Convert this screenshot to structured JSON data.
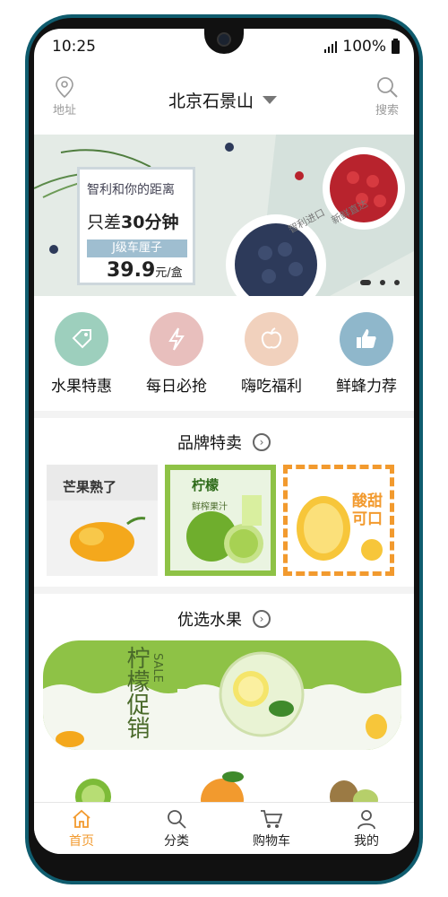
{
  "status_bar": {
    "time": "10:25",
    "battery": "100%"
  },
  "topbar": {
    "location_label": "地址",
    "city": "北京石景山",
    "search_label": "搜索"
  },
  "banner": {
    "headline": "智利和你的距离",
    "time_text_pre": "只差",
    "time_text_bold": "30分钟",
    "grade": "J级车厘子",
    "price": "39.9",
    "price_unit": "元/盒",
    "side_text_1": "智利进口",
    "side_text_2": "新鲜直达"
  },
  "categories": [
    {
      "label": "水果特惠",
      "color": "#9dcfbd",
      "icon": "tag-icon"
    },
    {
      "label": "每日必抢",
      "color": "#e8bfbd",
      "icon": "lightning-icon"
    },
    {
      "label": "嗨吃福利",
      "color": "#f1d1bd",
      "icon": "apple-icon"
    },
    {
      "label": "鲜蜂力荐",
      "color": "#8fb7cb",
      "icon": "thumbs-up-icon"
    }
  ],
  "brand_section": {
    "title": "品牌特卖",
    "items": [
      {
        "text": "芒果熟了"
      },
      {
        "text": "柠檬",
        "sub": "鲜榨果汁"
      },
      {
        "text": "酸甜可口"
      }
    ]
  },
  "fruit_section": {
    "title": "优选水果",
    "promo_title": "柠檬促销",
    "promo_sub": "SALE"
  },
  "nav": [
    {
      "label": "首页",
      "icon": "home-icon",
      "active": true
    },
    {
      "label": "分类",
      "icon": "search-icon",
      "active": false
    },
    {
      "label": "购物车",
      "icon": "cart-icon",
      "active": false
    },
    {
      "label": "我的",
      "icon": "user-icon",
      "active": false
    }
  ],
  "colors": {
    "accent": "#f29a2e",
    "frame": "#0f5c6e",
    "promo_green": "#8ec246"
  }
}
